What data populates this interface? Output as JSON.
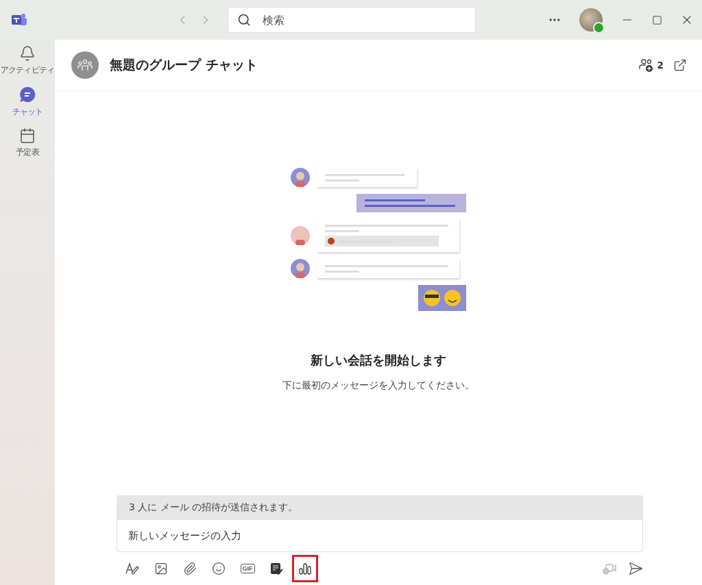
{
  "titlebar": {
    "search": {
      "placeholder": "検索"
    }
  },
  "sidebar": {
    "items": [
      {
        "kind": "bell",
        "label": "アクティビティ",
        "selected": false
      },
      {
        "kind": "chat",
        "label": "チャット",
        "selected": true
      },
      {
        "kind": "calendar",
        "label": "予定表",
        "selected": false
      }
    ]
  },
  "header": {
    "title": "無題のグループ チャット",
    "participants_count": "2"
  },
  "empty_state": {
    "heading": "新しい会話を開始します",
    "subtext": "下に最初のメッセージを入力してください。"
  },
  "composer": {
    "notice": "3 人に メール の招待が送信されます。",
    "placeholder": "新しいメッセージの入力"
  },
  "toolbar": [
    {
      "kind": "format",
      "highlighted": false
    },
    {
      "kind": "image",
      "highlighted": false
    },
    {
      "kind": "attach",
      "highlighted": false
    },
    {
      "kind": "emoji",
      "highlighted": false
    },
    {
      "kind": "gif",
      "label": "GIF",
      "highlighted": false
    },
    {
      "kind": "loop",
      "highlighted": false
    },
    {
      "kind": "poll",
      "highlighted": true
    }
  ]
}
